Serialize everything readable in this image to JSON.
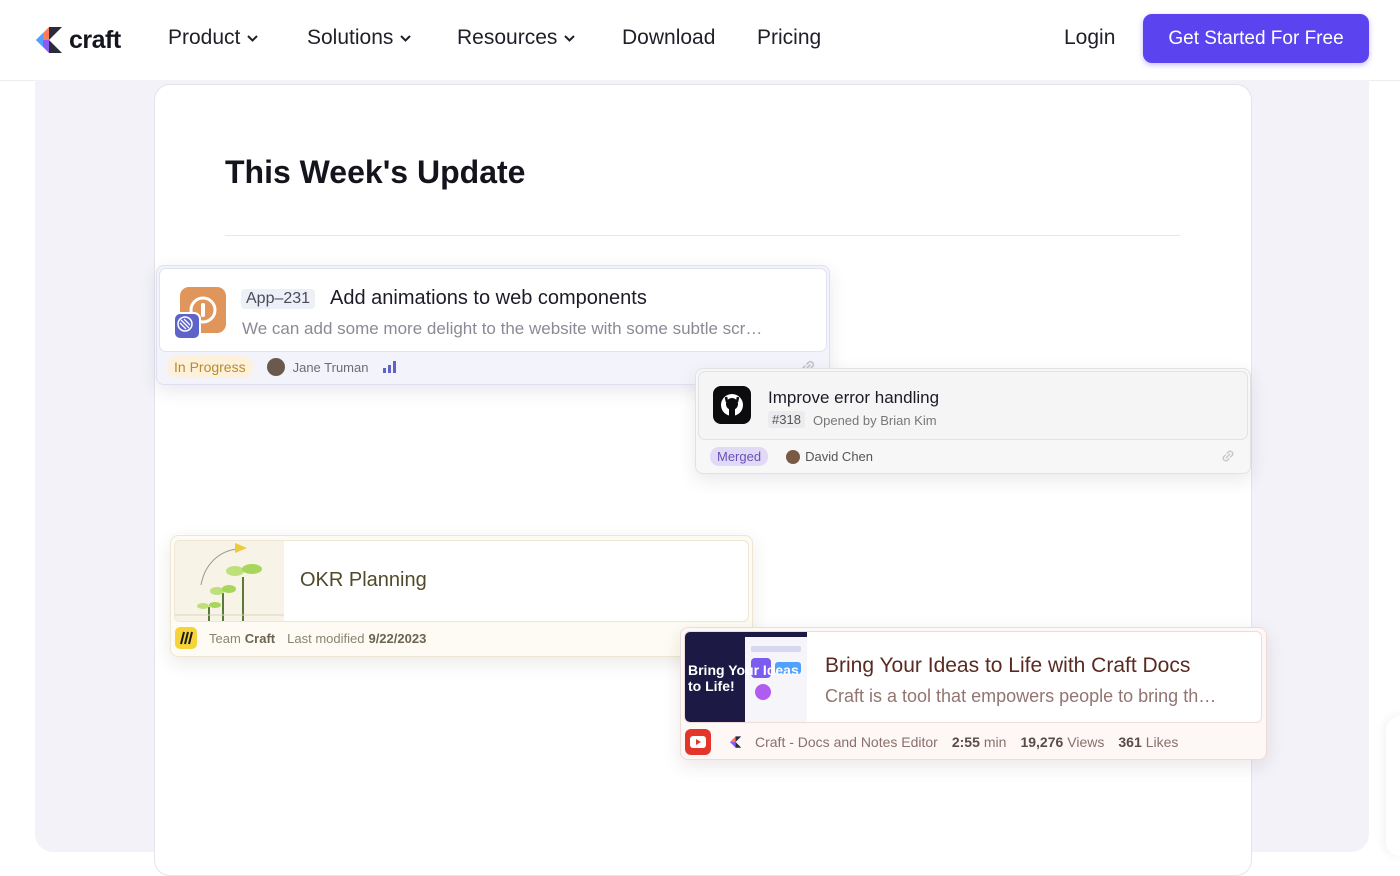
{
  "nav": {
    "logo_text": "craft",
    "items": [
      {
        "label": "Product",
        "has_dropdown": true
      },
      {
        "label": "Solutions",
        "has_dropdown": true
      },
      {
        "label": "Resources",
        "has_dropdown": true
      },
      {
        "label": "Download",
        "has_dropdown": false
      },
      {
        "label": "Pricing",
        "has_dropdown": false
      }
    ],
    "login": "Login",
    "cta": "Get Started For Free",
    "cta_color": "#5b43f0"
  },
  "doc": {
    "title": "This Week's Update"
  },
  "linear_card": {
    "icon": "linear-app-icon",
    "issue_id": "App–231",
    "title": "Add animations to web components",
    "description": "We can add some more delight to the website with some subtle scr…",
    "status": "In Progress",
    "assignee": "Jane Truman",
    "priority_icon": "priority-bars-icon"
  },
  "github_card": {
    "icon": "github-icon",
    "title": "Improve error handling",
    "number": "#318",
    "subtitle": "Opened by Brian Kim",
    "status": "Merged",
    "author": "David Chen"
  },
  "okr_card": {
    "title": "OKR Planning",
    "team_prefix": "Team",
    "team_name": "Craft",
    "modified_label": "Last modified",
    "modified_date": "9/22/2023"
  },
  "youtube_card": {
    "thumbnail_text": "Bring Your Ideas to Life!",
    "title": "Bring Your Ideas to Life with Craft Docs",
    "description": "Craft is a tool that empowers people to bring th…",
    "channel": "Craft - Docs and Notes Editor",
    "duration_value": "2:55",
    "duration_unit": "min",
    "views_value": "19,276",
    "views_unit": "Views",
    "likes_value": "361",
    "likes_unit": "Likes"
  }
}
